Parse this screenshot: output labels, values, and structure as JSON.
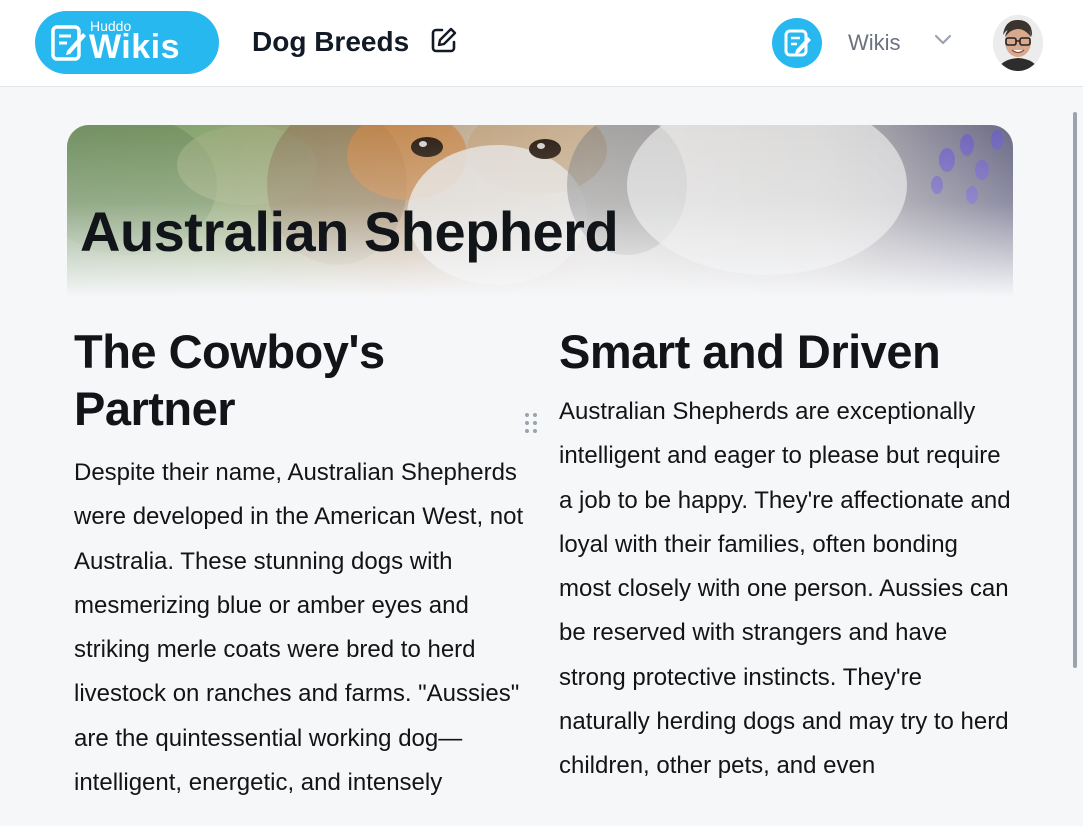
{
  "header": {
    "logo": {
      "small": "Huddo",
      "big": "Wikis"
    },
    "wiki_title": "Dog Breeds",
    "wikis_label": "Wikis",
    "icons": {
      "edit": "edit-icon",
      "wikis": "wikis-app-icon",
      "dropdown": "chevron-down-icon",
      "avatar": "user-avatar"
    }
  },
  "page": {
    "title": "Australian Shepherd",
    "columns": [
      {
        "heading": "The Cowboy's Partner",
        "body": "Despite their name, Australian Shepherds were developed in the American West, not Australia. These stunning dogs with mesmerizing blue or amber eyes and striking merle coats were bred to herd livestock on ranches and farms. \"Aussies\" are the quintessential working dog—intelligent, energetic, and intensely"
      },
      {
        "heading": "Smart and Driven",
        "body": "Australian Shepherds are exceptionally intelligent and eager to please but require a job to be happy. They're affectionate and loyal with their families, often bonding most closely with one person. Aussies can be reserved with strangers and have strong protective instincts. They're naturally herding dogs and may try to herd children, other pets, and even"
      }
    ]
  },
  "colors": {
    "brand": "#27b8ef",
    "background": "#f6f7f9",
    "text": "#141414"
  }
}
